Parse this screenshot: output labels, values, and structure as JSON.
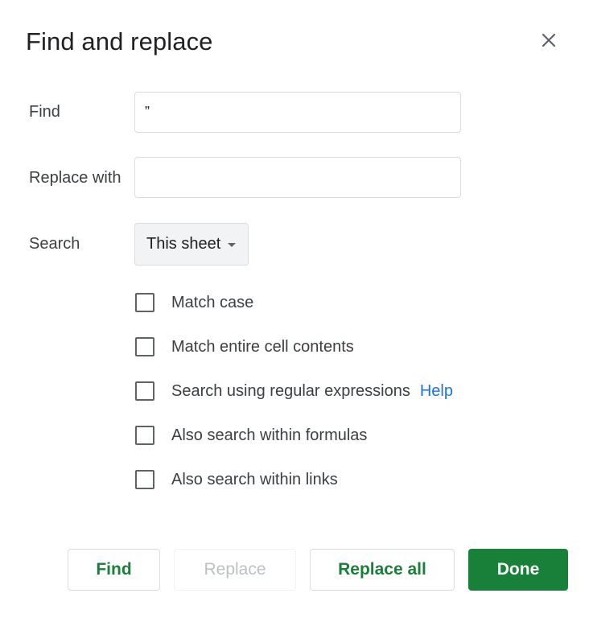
{
  "dialog": {
    "title": "Find and replace",
    "close_icon": "close-icon"
  },
  "fields": {
    "find_label": "Find",
    "find_value": "”",
    "replace_label": "Replace with",
    "replace_value": "",
    "search_label": "Search",
    "search_scope": "This sheet"
  },
  "options": [
    {
      "label": "Match case",
      "checked": false
    },
    {
      "label": "Match entire cell contents",
      "checked": false
    },
    {
      "label": "Search using regular expressions",
      "checked": false,
      "link": "Help"
    },
    {
      "label": "Also search within formulas",
      "checked": false
    },
    {
      "label": "Also search within links",
      "checked": false
    }
  ],
  "buttons": {
    "find": "Find",
    "replace": "Replace",
    "replace_all": "Replace all",
    "done": "Done"
  },
  "colors": {
    "primary_green": "#188038",
    "link_blue": "#1a73e8",
    "disabled_text": "#bdc1c6"
  }
}
